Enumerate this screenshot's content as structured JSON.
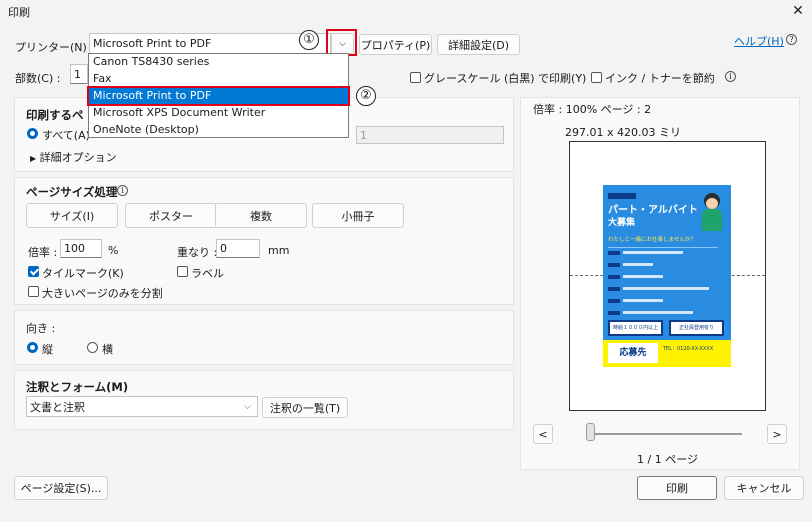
{
  "window": {
    "title": "印刷"
  },
  "printer": {
    "label": "プリンター(N) :",
    "selected": "Microsoft Print to PDF",
    "properties_button": "プロパティ(P)",
    "advanced_button": "詳細設定(D)",
    "options": [
      "Canon TS8430 series",
      "Fax",
      "Microsoft Print to PDF",
      "Microsoft XPS Document Writer",
      "OneNote (Desktop)"
    ],
    "highlighted_index": 2
  },
  "help": {
    "label": "ヘルプ(H)"
  },
  "copies": {
    "label": "部数(C) :",
    "value": "1"
  },
  "options_row": {
    "grayscale": "グレースケール (白黒) で印刷(Y)",
    "save_ink": "インク / トナーを節約"
  },
  "pages_to_print": {
    "heading": "印刷するペ",
    "all": "すべて(A)",
    "pages_value": "1",
    "more_options": "詳細オプション"
  },
  "page_sizing": {
    "heading": "ページサイズ処理",
    "buttons": [
      "サイズ(I)",
      "ポスター",
      "複数",
      "小冊子"
    ],
    "scale_label": "倍率 :",
    "scale_value": "100",
    "scale_unit": "%",
    "overlap_label": "重なり :",
    "overlap_value": "0",
    "overlap_unit": "mm",
    "tile_marks": "タイルマーク(K)",
    "labels": "ラベル",
    "split_large": "大きいページのみを分割"
  },
  "orientation": {
    "heading": "向き :",
    "portrait": "縦",
    "landscape": "横"
  },
  "comments": {
    "heading": "注釈とフォーム(M)",
    "selected": "文書と注釈",
    "summarize_button": "注釈の一覧(T)"
  },
  "preview": {
    "scale_text": "倍率 : 100% ページ : 2",
    "dimensions": "297.01 x 420.03 ミリ",
    "page_counter": "1 / 1 ページ",
    "flyer": {
      "title": "パート・アルバイト",
      "subtitle": "大募集",
      "tagline": "わたしと一緒にお仕事しませんか？",
      "box_left": "時給１０００円以上",
      "box_right": "正社員登用有り",
      "contact": "応募先",
      "phone": "TEL：0120-XX-XXXX"
    }
  },
  "footer": {
    "page_setup": "ページ設定(S)...",
    "print": "印刷",
    "cancel": "キャンセル"
  },
  "annotations": {
    "step1": "①",
    "step2": "②"
  }
}
